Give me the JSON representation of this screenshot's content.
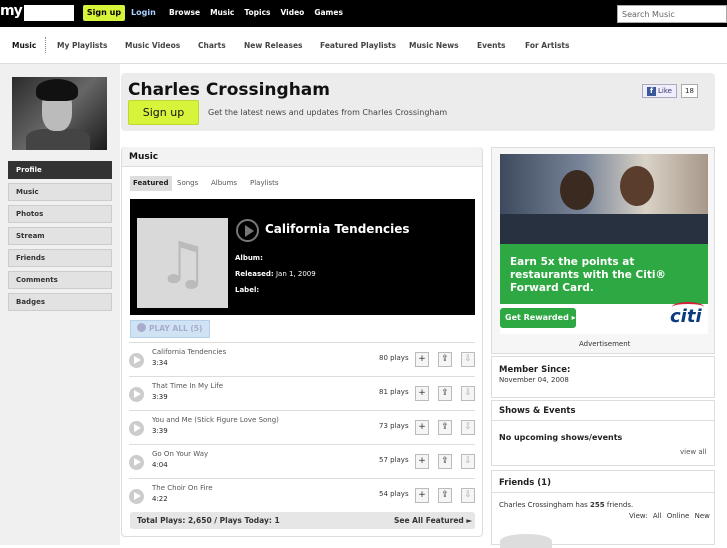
{
  "topbar": {
    "logo": "my",
    "signup": "Sign up",
    "login": "Login",
    "nav": [
      "Browse",
      "Music",
      "Topics",
      "Video",
      "Games"
    ],
    "search_placeholder": "Search Music"
  },
  "subnav": [
    "Music",
    "My Playlists",
    "Music Videos",
    "Charts",
    "New Releases",
    "Featured Playlists",
    "Music News",
    "Events",
    "For Artists"
  ],
  "sidebar": [
    "Profile",
    "Music",
    "Photos",
    "Stream",
    "Friends",
    "Comments",
    "Badges"
  ],
  "profile": {
    "name": "Charles Crossingham",
    "signup_label": "Sign up",
    "tagline": "Get the latest news and updates from Charles Crossingham",
    "fb_like": "Like",
    "fb_count": "18"
  },
  "music": {
    "title": "Music",
    "tabs": [
      "Featured",
      "Songs",
      "Albums",
      "Playlists"
    ],
    "featured": {
      "label": "",
      "title": "California Tendencies",
      "album_label": "Album:",
      "album": "",
      "released_label": "Released:",
      "released": "Jan 1, 2009",
      "label_label": "Label:"
    },
    "play_all": "PLAY ALL (5)",
    "tracks": [
      {
        "name": "California Tendencies",
        "duration": "3:34",
        "plays": "80 plays"
      },
      {
        "name": "That Time In My Life",
        "duration": "3:39",
        "plays": "81 plays"
      },
      {
        "name": "You and Me (Stick Figure Love Song)",
        "duration": "3:39",
        "plays": "73 plays"
      },
      {
        "name": "Go On Your Way",
        "duration": "4:04",
        "plays": "57 plays"
      },
      {
        "name": "The Choir On Fire",
        "duration": "4:22",
        "plays": "54 plays"
      }
    ],
    "total": "Total Plays: 2,650 / Plays Today: 1",
    "see_all": "See All Featured ►"
  },
  "ad": {
    "headline": "Earn 5x the points at restaurants with the Citi® Forward Card.",
    "cta": "Get Rewarded ▸",
    "brand": "citi",
    "label": "Advertisement"
  },
  "member": {
    "label": "Member Since:",
    "date": "November 04, 2008"
  },
  "shows": {
    "title": "Shows & Events",
    "empty": "No upcoming shows/events",
    "view_all": "view all"
  },
  "friends": {
    "title": "Friends (1)",
    "text_prefix": "Charles Crossingham has",
    "count": "255",
    "text_suffix": "friends.",
    "view_label": "View:",
    "filters": [
      "All",
      "Online",
      "New"
    ]
  },
  "colors": {
    "accent": "#d7f43b",
    "featured_label": "#e6842b",
    "ad_green": "#2ea843"
  }
}
